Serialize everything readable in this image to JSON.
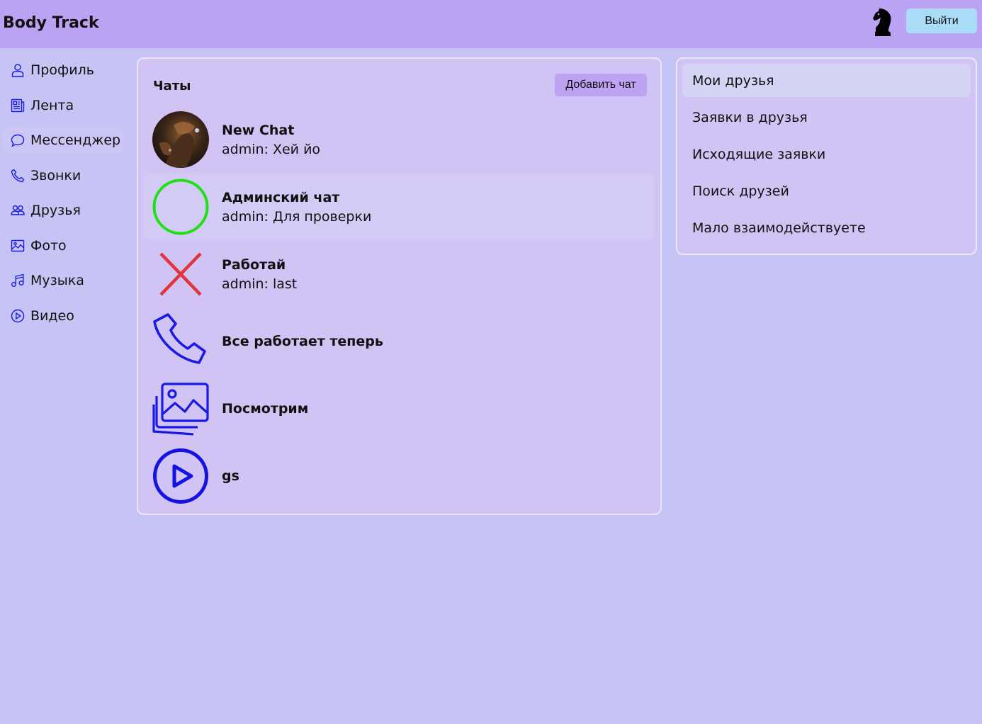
{
  "header": {
    "brand": "Body Track",
    "logout_label": "Выйти",
    "logo_icon": "chess-knight-icon"
  },
  "sidebar": {
    "items": [
      {
        "label": "Профиль",
        "icon": "person-icon"
      },
      {
        "label": "Лента",
        "icon": "newspaper-icon"
      },
      {
        "label": "Мессенджер",
        "icon": "chat-bubble-icon",
        "active": true
      },
      {
        "label": "Звонки",
        "icon": "phone-icon"
      },
      {
        "label": "Друзья",
        "icon": "people-icon"
      },
      {
        "label": "Фото",
        "icon": "image-icon"
      },
      {
        "label": "Музыка",
        "icon": "music-note-icon"
      },
      {
        "label": "Видео",
        "icon": "play-circle-icon"
      }
    ]
  },
  "chats": {
    "title": "Чаты",
    "add_label": "Добавить чат",
    "items": [
      {
        "name": "New Chat",
        "preview": "admin: Хей йо",
        "avatar": "photo-avatar"
      },
      {
        "name": "Админский чат",
        "preview": "admin: Для проверки",
        "avatar": "green-circle-icon",
        "active": true
      },
      {
        "name": "Работай",
        "preview": "admin: last",
        "avatar": "red-x-icon"
      },
      {
        "name": "Все работает теперь",
        "preview": "",
        "avatar": "phone-icon"
      },
      {
        "name": "Посмотрим",
        "preview": "",
        "avatar": "image-icon"
      },
      {
        "name": "gs",
        "preview": "",
        "avatar": "play-circle-icon"
      }
    ]
  },
  "friends_menu": {
    "items": [
      {
        "label": "Мои друзья",
        "active": true
      },
      {
        "label": "Заявки в друзья"
      },
      {
        "label": "Исходящие заявки"
      },
      {
        "label": "Поиск друзей"
      },
      {
        "label": "Мало взаимодействуете"
      }
    ]
  },
  "colors": {
    "page_bg": "#c6c4f4",
    "header_bg": "#bba3f4",
    "card_bg": "#d1c4f5",
    "icon_blue": "#1a1ae6",
    "logout_bg": "#a9dcf6",
    "add_chat_bg": "#bea3f3"
  }
}
